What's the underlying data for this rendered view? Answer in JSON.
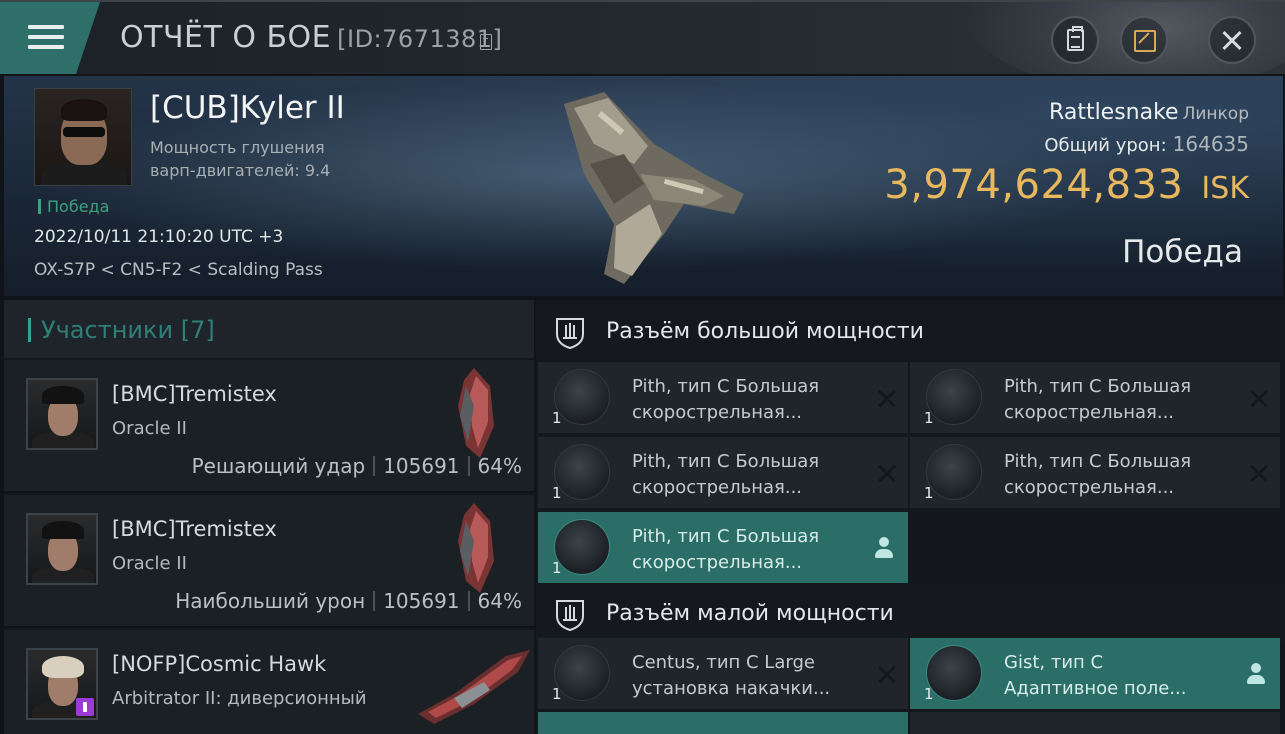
{
  "header": {
    "title": "ОТЧЁТ О БОЕ",
    "report_id": "[ID:7671381]",
    "icons": {
      "menu": "menu-icon",
      "copy": "copy-icon",
      "clipboard": "clipboard-icon",
      "share": "share-icon",
      "close": "close-icon"
    }
  },
  "summary": {
    "pilot": "[CUB]Kyler II",
    "scram_strength": "Мощность глушения варп-двигателей: 9.4",
    "result_tag": "Победа",
    "datetime": "2022/10/11 21:10:20 UTC +3",
    "location": "OX-S7P < CN5-F2 < Scalding Pass",
    "ship_name": "Rattlesnake",
    "ship_class": "Линкор",
    "total_damage_label": "Общий урон:",
    "total_damage": "164635",
    "isk_value": "3,974,624,833",
    "isk_unit": "ISK",
    "result": "Победа"
  },
  "participants": {
    "header": "Участники [7]",
    "rows": [
      {
        "name": "[BMC]Tremistex",
        "ship": "Oracle II",
        "role": "Решающий удар",
        "damage": "105691",
        "percent": "64%"
      },
      {
        "name": "[BMC]Tremistex",
        "ship": "Oracle II",
        "role": "Наибольший урон",
        "damage": "105691",
        "percent": "64%"
      },
      {
        "name": "[NOFP]Cosmic Hawk",
        "ship": "Arbitrator II: диверсионный",
        "role": "",
        "damage": "",
        "percent": ""
      }
    ]
  },
  "fitting": {
    "high_slot_title": "Разъём большой мощности",
    "low_slot_title": "Разъём малой мощности",
    "high_modules": [
      {
        "line1": "Pith, тип C Большая",
        "line2": "скорострельная...",
        "qty": "1",
        "state": "destroyed"
      },
      {
        "line1": "Pith, тип C Большая",
        "line2": "скорострельная...",
        "qty": "1",
        "state": "destroyed"
      },
      {
        "line1": "Pith, тип C Большая",
        "line2": "скорострельная...",
        "qty": "1",
        "state": "destroyed"
      },
      {
        "line1": "Pith, тип C Большая",
        "line2": "скорострельная...",
        "qty": "1",
        "state": "destroyed"
      },
      {
        "line1": "Pith, тип C Большая",
        "line2": "скорострельная...",
        "qty": "1",
        "state": "dropped"
      }
    ],
    "low_modules": [
      {
        "line1": "Centus, тип C Large",
        "line2": "установка накачки...",
        "qty": "1",
        "state": "destroyed"
      },
      {
        "line1": "Gist, тип C",
        "line2": "Адаптивное поле...",
        "qty": "1",
        "state": "dropped"
      }
    ]
  },
  "colors": {
    "accent_teal": "#2a6e67",
    "isk_gold": "#e7b85e",
    "victory_green": "#3fa07e",
    "panel_bg": "#1f252a"
  }
}
